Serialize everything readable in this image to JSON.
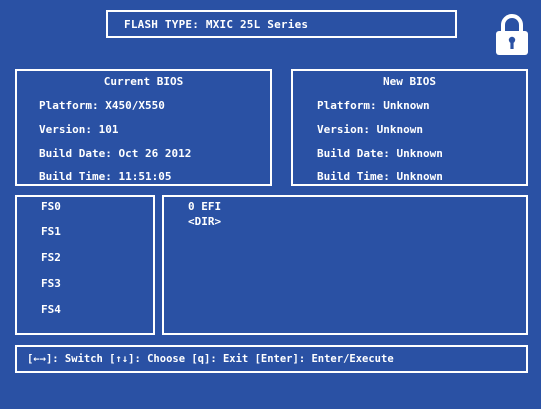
{
  "flash_type": "FLASH TYPE: MXIC 25L Series",
  "lock_icon": "padlock-icon",
  "current_bios": {
    "title": "Current BIOS",
    "platform": "Platform: X450/X550",
    "version": "Version: 101",
    "build_date": "Build Date: Oct 26 2012",
    "build_time": "Build Time: 11:51:05"
  },
  "new_bios": {
    "title": "New BIOS",
    "platform": "Platform: Unknown",
    "version": "Version: Unknown",
    "build_date": "Build Date: Unknown",
    "build_time": "Build Time: Unknown"
  },
  "file_systems": [
    "FS0",
    "FS1",
    "FS2",
    "FS3",
    "FS4"
  ],
  "directory": [
    "0 EFI",
    "<DIR>"
  ],
  "status_bar": "[←→]: Switch [↑↓]: Choose [q]: Exit [Enter]: Enter/Execute",
  "colors": {
    "background": "#2a51a4",
    "foreground": "#ffffff"
  }
}
